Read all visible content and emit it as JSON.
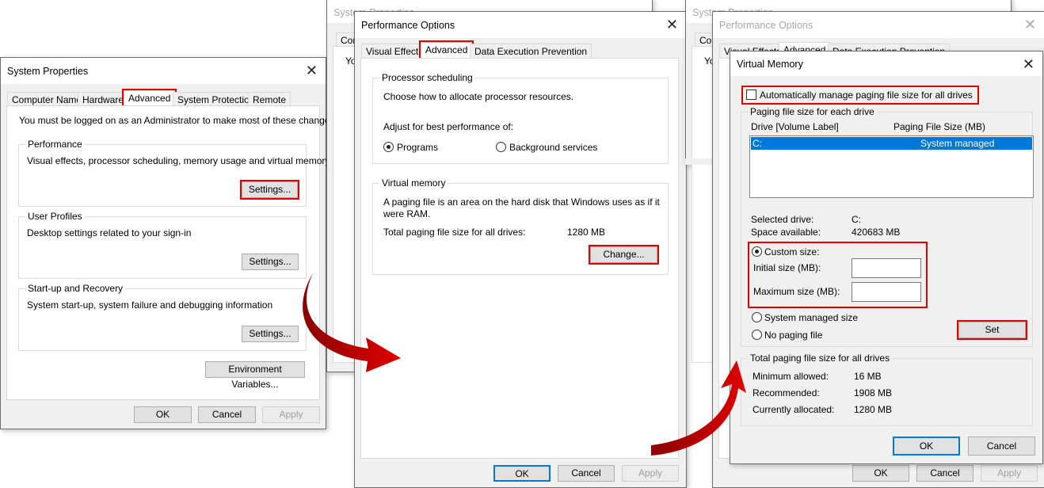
{
  "system_properties": {
    "title": "System Properties",
    "tabs": [
      "Computer Name",
      "Hardware",
      "Advanced",
      "System Protection",
      "Remote"
    ],
    "admin_note": "You must be logged on as an Administrator to make most of these changes.",
    "groups": [
      {
        "label": "Performance",
        "desc": "Visual effects, processor scheduling, memory usage and virtual memory",
        "button": "Settings..."
      },
      {
        "label": "User Profiles",
        "desc": "Desktop settings related to your sign-in",
        "button": "Settings..."
      },
      {
        "label": "Start-up and Recovery",
        "desc": "System start-up, system failure and debugging information",
        "button": "Settings..."
      }
    ],
    "env_button": "Environment Variables...",
    "ok": "OK",
    "cancel": "Cancel",
    "apply": "Apply",
    "bg_title": "System Properties",
    "bg_tab": "Com",
    "bg_text": "Yo"
  },
  "performance_options": {
    "title": "Performance Options",
    "tabs": [
      "Visual Effects",
      "Advanced",
      "Data Execution Prevention"
    ],
    "processor": {
      "label": "Processor scheduling",
      "desc": "Choose how to allocate processor resources.",
      "adjust": "Adjust for best performance of:",
      "options": [
        "Programs",
        "Background services"
      ],
      "selected": "Programs"
    },
    "virtual_memory": {
      "label": "Virtual memory",
      "desc": "A paging file is an area on the hard disk that Windows uses as if it were RAM.",
      "total_label": "Total paging file size for all drives:",
      "total_value": "1280 MB",
      "change": "Change..."
    },
    "ok": "OK",
    "cancel": "Cancel",
    "apply": "Apply"
  },
  "virtual_memory": {
    "title": "Virtual Memory",
    "auto_manage": "Automatically manage paging file size for all drives",
    "auto_checked": false,
    "each_drive_label": "Paging file size for each drive",
    "col_drive": "Drive  [Volume Label]",
    "col_size": "Paging File Size (MB)",
    "drives": [
      {
        "drive": "C:",
        "size": "System managed"
      }
    ],
    "selected_drive_label": "Selected drive:",
    "selected_drive": "C:",
    "space_label": "Space available:",
    "space": "420683 MB",
    "custom_size": "Custom size:",
    "initial_label": "Initial size (MB):",
    "initial_value": "",
    "maximum_label": "Maximum size (MB):",
    "maximum_value": "",
    "system_managed": "System managed size",
    "no_paging": "No paging file",
    "selected_option": "Custom size",
    "set": "Set",
    "total_label": "Total paging file size for all drives",
    "min_label": "Minimum allowed:",
    "min": "16 MB",
    "rec_label": "Recommended:",
    "rec": "1908 MB",
    "cur_label": "Currently allocated:",
    "cur": "1280 MB",
    "ok": "OK",
    "cancel": "Cancel"
  },
  "colors": {
    "highlight": "#e00000",
    "selection": "#0078d7",
    "arrow": "#c00000"
  }
}
